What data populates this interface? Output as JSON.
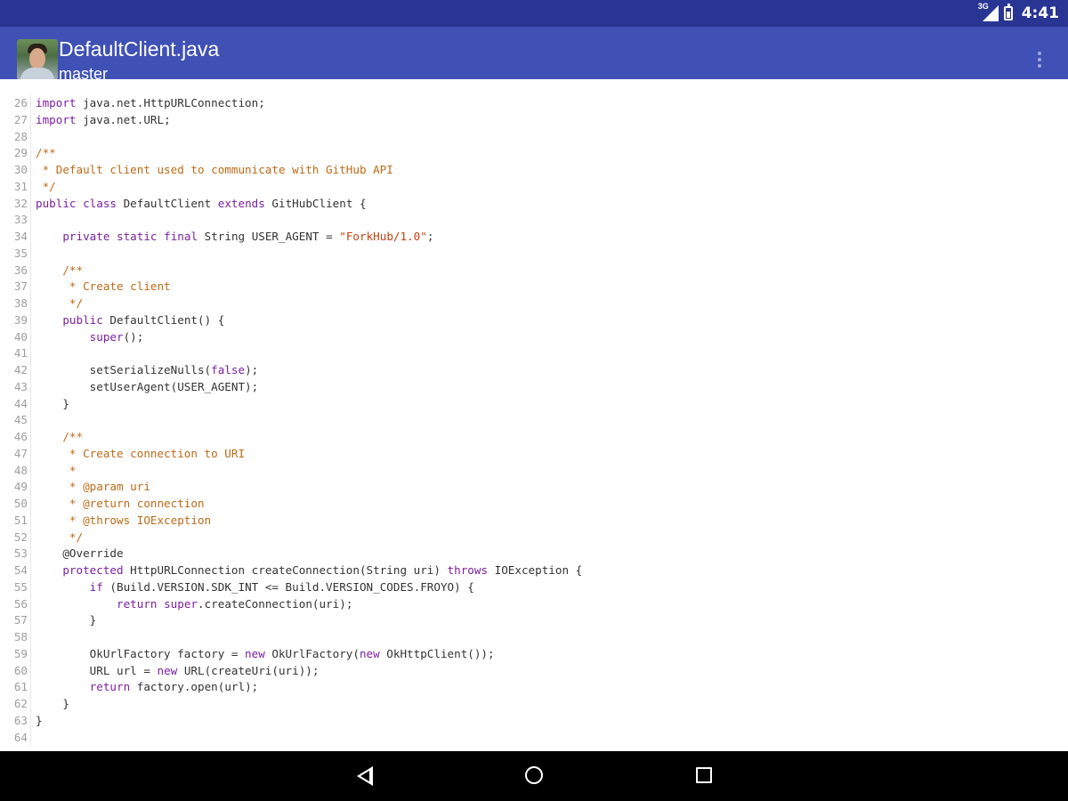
{
  "status_bar": {
    "network_label": "3G",
    "time": "4:41",
    "icons": [
      "signal-icon",
      "battery-icon"
    ]
  },
  "app_bar": {
    "title": "DefaultClient.java",
    "subtitle": "master",
    "overflow_icon": "more-vert-icon",
    "color": "#3f51b5"
  },
  "code": {
    "lines": [
      {
        "num": 26,
        "tokens": [
          [
            "kw",
            "import"
          ],
          [
            "tx",
            " java.net.HttpURLConnection;"
          ]
        ]
      },
      {
        "num": 27,
        "tokens": [
          [
            "kw",
            "import"
          ],
          [
            "tx",
            " java.net.URL;"
          ]
        ]
      },
      {
        "num": 28,
        "tokens": []
      },
      {
        "num": 29,
        "tokens": [
          [
            "cm",
            "/**"
          ]
        ]
      },
      {
        "num": 30,
        "tokens": [
          [
            "cm",
            " * Default client used to communicate with GitHub API"
          ]
        ]
      },
      {
        "num": 31,
        "tokens": [
          [
            "cm",
            " */"
          ]
        ]
      },
      {
        "num": 32,
        "tokens": [
          [
            "kw",
            "public"
          ],
          [
            "tx",
            " "
          ],
          [
            "kw",
            "class"
          ],
          [
            "tx",
            " DefaultClient "
          ],
          [
            "kw",
            "extends"
          ],
          [
            "tx",
            " GitHubClient {"
          ]
        ]
      },
      {
        "num": 33,
        "tokens": []
      },
      {
        "num": 34,
        "tokens": [
          [
            "tx",
            "    "
          ],
          [
            "kw",
            "private"
          ],
          [
            "tx",
            " "
          ],
          [
            "kw",
            "static"
          ],
          [
            "tx",
            " "
          ],
          [
            "kw",
            "final"
          ],
          [
            "tx",
            " String USER_AGENT = "
          ],
          [
            "st",
            "\"ForkHub/1.0\""
          ],
          [
            "tx",
            ";"
          ]
        ]
      },
      {
        "num": 35,
        "tokens": []
      },
      {
        "num": 36,
        "tokens": [
          [
            "cm",
            "    /**"
          ]
        ]
      },
      {
        "num": 37,
        "tokens": [
          [
            "cm",
            "     * Create client"
          ]
        ]
      },
      {
        "num": 38,
        "tokens": [
          [
            "cm",
            "     */"
          ]
        ]
      },
      {
        "num": 39,
        "tokens": [
          [
            "tx",
            "    "
          ],
          [
            "kw",
            "public"
          ],
          [
            "tx",
            " DefaultClient() {"
          ]
        ]
      },
      {
        "num": 40,
        "tokens": [
          [
            "tx",
            "        "
          ],
          [
            "kw",
            "super"
          ],
          [
            "tx",
            "();"
          ]
        ]
      },
      {
        "num": 41,
        "tokens": []
      },
      {
        "num": 42,
        "tokens": [
          [
            "tx",
            "        setSerializeNulls("
          ],
          [
            "kw",
            "false"
          ],
          [
            "tx",
            ");"
          ]
        ]
      },
      {
        "num": 43,
        "tokens": [
          [
            "tx",
            "        setUserAgent(USER_AGENT);"
          ]
        ]
      },
      {
        "num": 44,
        "tokens": [
          [
            "tx",
            "    }"
          ]
        ]
      },
      {
        "num": 45,
        "tokens": []
      },
      {
        "num": 46,
        "tokens": [
          [
            "cm",
            "    /**"
          ]
        ]
      },
      {
        "num": 47,
        "tokens": [
          [
            "cm",
            "     * Create connection to URI"
          ]
        ]
      },
      {
        "num": 48,
        "tokens": [
          [
            "cm",
            "     *"
          ]
        ]
      },
      {
        "num": 49,
        "tokens": [
          [
            "cm",
            "     * @param uri"
          ]
        ]
      },
      {
        "num": 50,
        "tokens": [
          [
            "cm",
            "     * @return connection"
          ]
        ]
      },
      {
        "num": 51,
        "tokens": [
          [
            "cm",
            "     * @throws IOException"
          ]
        ]
      },
      {
        "num": 52,
        "tokens": [
          [
            "cm",
            "     */"
          ]
        ]
      },
      {
        "num": 53,
        "tokens": [
          [
            "tx",
            "    @Override"
          ]
        ]
      },
      {
        "num": 54,
        "tokens": [
          [
            "tx",
            "    "
          ],
          [
            "kw",
            "protected"
          ],
          [
            "tx",
            " HttpURLConnection createConnection(String uri) "
          ],
          [
            "kw",
            "throws"
          ],
          [
            "tx",
            " IOException {"
          ]
        ]
      },
      {
        "num": 55,
        "tokens": [
          [
            "tx",
            "        "
          ],
          [
            "kw",
            "if"
          ],
          [
            "tx",
            " (Build.VERSION.SDK_INT <= Build.VERSION_CODES.FROYO) {"
          ]
        ]
      },
      {
        "num": 56,
        "tokens": [
          [
            "tx",
            "            "
          ],
          [
            "kw",
            "return"
          ],
          [
            "tx",
            " "
          ],
          [
            "kw",
            "super"
          ],
          [
            "tx",
            ".createConnection(uri);"
          ]
        ]
      },
      {
        "num": 57,
        "tokens": [
          [
            "tx",
            "        }"
          ]
        ]
      },
      {
        "num": 58,
        "tokens": []
      },
      {
        "num": 59,
        "tokens": [
          [
            "tx",
            "        OkUrlFactory factory = "
          ],
          [
            "kw",
            "new"
          ],
          [
            "tx",
            " OkUrlFactory("
          ],
          [
            "kw",
            "new"
          ],
          [
            "tx",
            " OkHttpClient());"
          ]
        ]
      },
      {
        "num": 60,
        "tokens": [
          [
            "tx",
            "        URL url = "
          ],
          [
            "kw",
            "new"
          ],
          [
            "tx",
            " URL(createUri(uri));"
          ]
        ]
      },
      {
        "num": 61,
        "tokens": [
          [
            "tx",
            "        "
          ],
          [
            "kw",
            "return"
          ],
          [
            "tx",
            " factory.open(url);"
          ]
        ]
      },
      {
        "num": 62,
        "tokens": [
          [
            "tx",
            "    }"
          ]
        ]
      },
      {
        "num": 63,
        "tokens": [
          [
            "tx",
            "}"
          ]
        ]
      },
      {
        "num": 64,
        "tokens": []
      }
    ],
    "keyword_color": "#7b1fa2",
    "comment_color": "#bf6a17"
  },
  "nav_bar": {
    "buttons": [
      "back-icon",
      "home-icon",
      "recents-icon"
    ]
  }
}
